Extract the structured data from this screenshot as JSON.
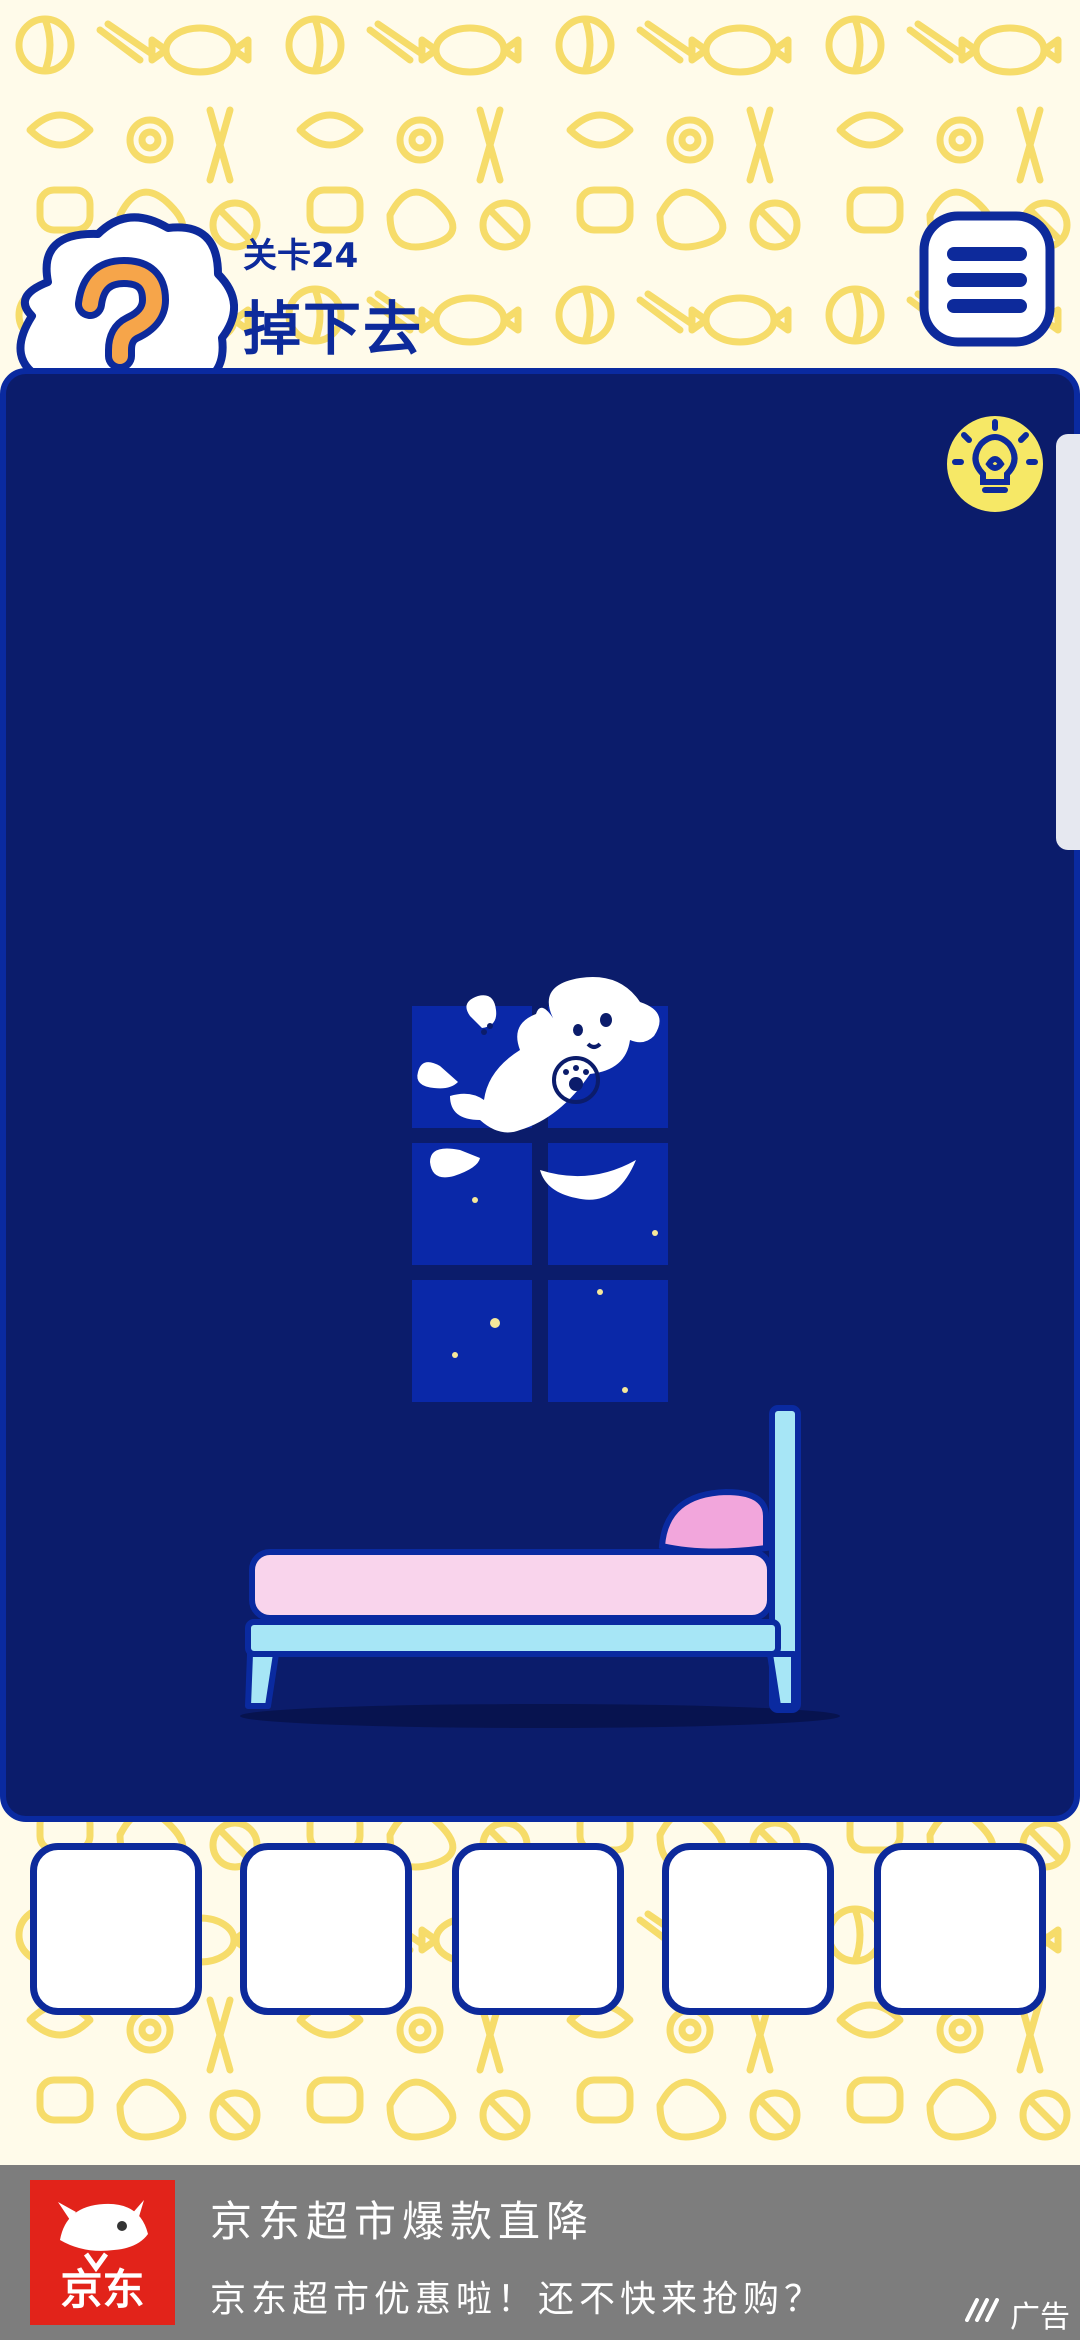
{
  "colors": {
    "navy": "#0d2a9b",
    "stage_bg": "#0b1c6b",
    "window_glass": "#0a28a8",
    "candy_yellow": "#f6dc6a",
    "bed_frame": "#a7e6f6",
    "mattress": "#f9d4ec",
    "pillow": "#f2a6dc",
    "hint_orange": "#f6a54a",
    "ad_red": "#e2231a"
  },
  "header": {
    "hint_icon": "question-mark-icon",
    "level_label": "关卡24",
    "level_title": "掉下去",
    "menu_icon": "hamburger-menu-icon"
  },
  "stage": {
    "hint_button_icon": "lightbulb-icon",
    "objects": [
      "window",
      "dog",
      "bed",
      "pillow"
    ]
  },
  "inventory": {
    "slots": [
      "",
      "",
      "",
      "",
      ""
    ]
  },
  "ad": {
    "logo_text": "京东",
    "title": "京东超市爆款直降",
    "description": "京东超市优惠啦！还不快来抢购？",
    "label": "广告",
    "mark_icon": "ad-mark-icon"
  }
}
